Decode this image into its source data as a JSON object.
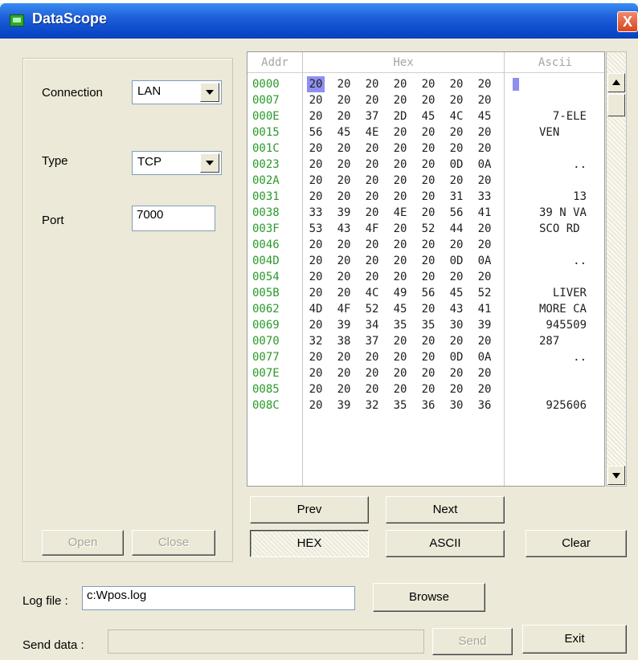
{
  "window": {
    "title": "DataScope",
    "close_glyph": "X",
    "icon": "app-icon"
  },
  "settings": {
    "connection_label": "Connection",
    "connection_value": "LAN",
    "type_label": "Type",
    "type_value": "TCP",
    "port_label": "Port",
    "port_value": "7000",
    "open_label": "Open",
    "close_label": "Close"
  },
  "viewer": {
    "headers": {
      "addr": "Addr",
      "hex": "Hex",
      "ascii": "Ascii"
    },
    "rows": [
      {
        "addr": "0000",
        "bytes": [
          "20",
          "20",
          "20",
          "20",
          "20",
          "20",
          "20"
        ],
        "ascii": ""
      },
      {
        "addr": "0007",
        "bytes": [
          "20",
          "20",
          "20",
          "20",
          "20",
          "20",
          "20"
        ],
        "ascii": ""
      },
      {
        "addr": "000E",
        "bytes": [
          "20",
          "20",
          "37",
          "2D",
          "45",
          "4C",
          "45"
        ],
        "ascii": "7-ELE"
      },
      {
        "addr": "0015",
        "bytes": [
          "56",
          "45",
          "4E",
          "20",
          "20",
          "20",
          "20"
        ],
        "ascii": "VEN    "
      },
      {
        "addr": "001C",
        "bytes": [
          "20",
          "20",
          "20",
          "20",
          "20",
          "20",
          "20"
        ],
        "ascii": ""
      },
      {
        "addr": "0023",
        "bytes": [
          "20",
          "20",
          "20",
          "20",
          "20",
          "0D",
          "0A"
        ],
        "ascii": ".."
      },
      {
        "addr": "002A",
        "bytes": [
          "20",
          "20",
          "20",
          "20",
          "20",
          "20",
          "20"
        ],
        "ascii": ""
      },
      {
        "addr": "0031",
        "bytes": [
          "20",
          "20",
          "20",
          "20",
          "20",
          "31",
          "33"
        ],
        "ascii": "13"
      },
      {
        "addr": "0038",
        "bytes": [
          "33",
          "39",
          "20",
          "4E",
          "20",
          "56",
          "41"
        ],
        "ascii": "39 N VA"
      },
      {
        "addr": "003F",
        "bytes": [
          "53",
          "43",
          "4F",
          "20",
          "52",
          "44",
          "20"
        ],
        "ascii": "SCO RD "
      },
      {
        "addr": "0046",
        "bytes": [
          "20",
          "20",
          "20",
          "20",
          "20",
          "20",
          "20"
        ],
        "ascii": ""
      },
      {
        "addr": "004D",
        "bytes": [
          "20",
          "20",
          "20",
          "20",
          "20",
          "0D",
          "0A"
        ],
        "ascii": ".."
      },
      {
        "addr": "0054",
        "bytes": [
          "20",
          "20",
          "20",
          "20",
          "20",
          "20",
          "20"
        ],
        "ascii": ""
      },
      {
        "addr": "005B",
        "bytes": [
          "20",
          "20",
          "4C",
          "49",
          "56",
          "45",
          "52"
        ],
        "ascii": "LIVER"
      },
      {
        "addr": "0062",
        "bytes": [
          "4D",
          "4F",
          "52",
          "45",
          "20",
          "43",
          "41"
        ],
        "ascii": "MORE CA"
      },
      {
        "addr": "0069",
        "bytes": [
          "20",
          "39",
          "34",
          "35",
          "35",
          "30",
          "39"
        ],
        "ascii": "945509"
      },
      {
        "addr": "0070",
        "bytes": [
          "32",
          "38",
          "37",
          "20",
          "20",
          "20",
          "20"
        ],
        "ascii": "287    "
      },
      {
        "addr": "0077",
        "bytes": [
          "20",
          "20",
          "20",
          "20",
          "20",
          "0D",
          "0A"
        ],
        "ascii": ".."
      },
      {
        "addr": "007E",
        "bytes": [
          "20",
          "20",
          "20",
          "20",
          "20",
          "20",
          "20"
        ],
        "ascii": ""
      },
      {
        "addr": "0085",
        "bytes": [
          "20",
          "20",
          "20",
          "20",
          "20",
          "20",
          "20"
        ],
        "ascii": ""
      },
      {
        "addr": "008C",
        "bytes": [
          "20",
          "39",
          "32",
          "35",
          "36",
          "30",
          "36"
        ],
        "ascii": "925606"
      }
    ],
    "selected": {
      "row": 0,
      "byte": 0
    }
  },
  "buttons": {
    "prev": "Prev",
    "next": "Next",
    "hex": "HEX",
    "ascii": "ASCII",
    "clear": "Clear",
    "browse": "Browse",
    "send": "Send",
    "exit": "Exit"
  },
  "log": {
    "label": "Log file :",
    "value": "c:Wpos.log"
  },
  "send": {
    "label": "Send data :",
    "value": ""
  }
}
